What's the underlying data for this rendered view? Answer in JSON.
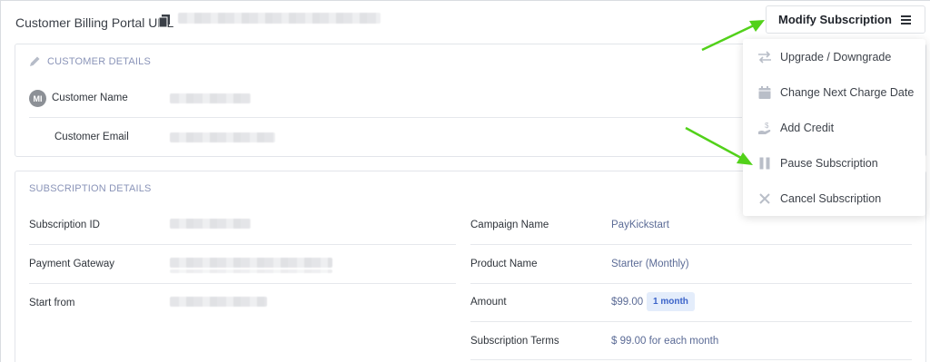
{
  "header": {
    "portal_label": "Customer Billing Portal URL",
    "copy_icon": "copy-icon"
  },
  "actions": {
    "modify_label": "Modify Subscription",
    "menu_icon": "hamburger-icon",
    "menu_items": [
      {
        "label": "Upgrade / Downgrade",
        "icon": "swap-arrows-icon"
      },
      {
        "label": "Change Next Charge Date",
        "icon": "calendar-icon"
      },
      {
        "label": "Add Credit",
        "icon": "hand-dollar-icon"
      },
      {
        "label": "Pause Subscription",
        "icon": "pause-icon"
      },
      {
        "label": "Cancel Subscription",
        "icon": "close-icon"
      }
    ]
  },
  "customer": {
    "section_title": "CUSTOMER DETAILS",
    "avatar_initials": "MI",
    "name_label": "Customer Name",
    "email_label": "Customer Email"
  },
  "subscription": {
    "section_title": "SUBSCRIPTION DETAILS",
    "left_rows": [
      {
        "label": "Subscription ID"
      },
      {
        "label": "Payment Gateway"
      },
      {
        "label": "Start from"
      }
    ],
    "right_rows": [
      {
        "label": "Campaign Name",
        "value": "PayKickstart"
      },
      {
        "label": "Product Name",
        "value": "Starter (Monthly)"
      },
      {
        "label": "Amount",
        "value": "$99.00",
        "badge": "1 month"
      },
      {
        "label": "Subscription Terms",
        "value": "$ 99.00 for each month"
      }
    ]
  },
  "colors": {
    "accent_link": "#5b6b96",
    "section_title": "#8a94b8",
    "badge_bg": "#e4edfb",
    "badge_text": "#3b63c9",
    "arrow_green": "#52d11a"
  }
}
